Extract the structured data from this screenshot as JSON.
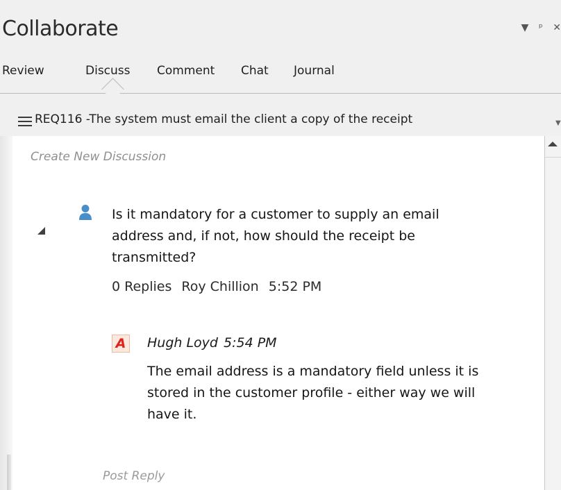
{
  "window": {
    "title": "Collaborate",
    "icons": [
      "dropdown-arrow-icon",
      "pin-icon",
      "close-icon"
    ]
  },
  "tabs": [
    {
      "label": "Review"
    },
    {
      "label": "Discuss",
      "selected": true
    },
    {
      "label": "Comment"
    },
    {
      "label": "Chat"
    },
    {
      "label": "Journal"
    }
  ],
  "requirement": {
    "title": "REQ116 -The system must email the client a copy of the receipt"
  },
  "discussion": {
    "create_placeholder": "Create New Discussion",
    "question": {
      "text": "Is it mandatory for a customer to supply an email address and, if not, how should the receipt be transmitted?",
      "replies": "0 Replies",
      "author": "Roy Chillion",
      "time": "5:52 PM"
    },
    "reply": {
      "avatar_letter": "A",
      "author": "Hugh Loyd",
      "time": "5:54 PM",
      "text": "The email address is a mandatory field unless it is stored in the customer profile - either way we will have it."
    },
    "post_reply_placeholder": "Post Reply"
  },
  "colors": {
    "accent_user_icon": "#4a8ec9",
    "reply_avatar_letter": "#e0201a",
    "reply_avatar_bg": "#fde8de"
  }
}
